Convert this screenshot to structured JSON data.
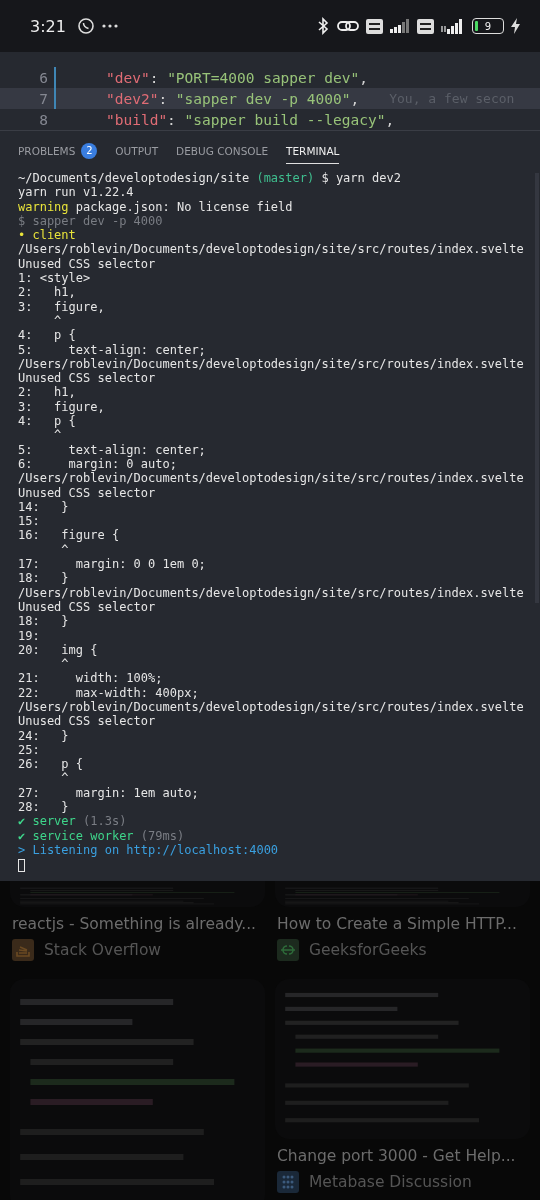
{
  "status_bar": {
    "time": "3:21",
    "battery": "9"
  },
  "editor": {
    "lines": [
      {
        "number": "6",
        "modified": true,
        "highlighted": false,
        "parts": [
          {
            "text": "\"dev\"",
            "kind": "key"
          },
          {
            "text": ": ",
            "kind": "plain"
          },
          {
            "text": "\"PORT=4000 sapper dev\"",
            "kind": "string"
          },
          {
            "text": ",",
            "kind": "plain"
          }
        ]
      },
      {
        "number": "7",
        "modified": true,
        "highlighted": true,
        "blame": "You, a few secon",
        "parts": [
          {
            "text": "\"dev2\"",
            "kind": "key"
          },
          {
            "text": ": ",
            "kind": "plain"
          },
          {
            "text": "\"sapper dev -p 4000\"",
            "kind": "string"
          },
          {
            "text": ",",
            "kind": "plain"
          }
        ]
      },
      {
        "number": "8",
        "modified": false,
        "highlighted": false,
        "parts": [
          {
            "text": "\"build\"",
            "kind": "key"
          },
          {
            "text": ": ",
            "kind": "plain"
          },
          {
            "text": "\"sapper build --legacy\"",
            "kind": "string"
          },
          {
            "text": ",",
            "kind": "plain"
          }
        ]
      }
    ]
  },
  "panel": {
    "tabs": [
      {
        "label": "PROBLEMS",
        "badge": "2",
        "selected": false
      },
      {
        "label": "OUTPUT",
        "selected": false
      },
      {
        "label": "DEBUG CONSOLE",
        "selected": false
      },
      {
        "label": "TERMINAL",
        "selected": true
      }
    ]
  },
  "terminal": {
    "cursor": true,
    "lines": [
      {
        "parts": [
          {
            "text": "~/Documents/developtodesign/site ",
            "kind": "plain"
          },
          {
            "text": "(master)",
            "kind": "branch"
          },
          {
            "text": " $ yarn dev2",
            "kind": "plain"
          }
        ]
      },
      {
        "parts": [
          {
            "text": "yarn run v1.22.4",
            "kind": "plain"
          }
        ]
      },
      {
        "parts": [
          {
            "text": "warning",
            "kind": "warning"
          },
          {
            "text": " package.json: No license field",
            "kind": "plain"
          }
        ]
      },
      {
        "parts": [
          {
            "text": "$ sapper dev -p 4000",
            "kind": "dim"
          }
        ]
      },
      {
        "parts": [
          {
            "text": "• client",
            "kind": "warning"
          }
        ]
      },
      {
        "parts": [
          {
            "text": "/Users/roblevin/Documents/developtodesign/site/src/routes/index.svelte",
            "kind": "plain"
          }
        ]
      },
      {
        "parts": [
          {
            "text": "Unused CSS selector",
            "kind": "plain"
          }
        ]
      },
      {
        "parts": [
          {
            "text": "1: <style>",
            "kind": "plain"
          }
        ]
      },
      {
        "parts": [
          {
            "text": "2:   h1,",
            "kind": "plain"
          }
        ]
      },
      {
        "parts": [
          {
            "text": "3:   figure,",
            "kind": "plain"
          }
        ]
      },
      {
        "parts": [
          {
            "text": "     ^",
            "kind": "plain"
          }
        ]
      },
      {
        "parts": [
          {
            "text": "4:   p {",
            "kind": "plain"
          }
        ]
      },
      {
        "parts": [
          {
            "text": "5:     text-align: center;",
            "kind": "plain"
          }
        ]
      },
      {
        "parts": [
          {
            "text": "/Users/roblevin/Documents/developtodesign/site/src/routes/index.svelte",
            "kind": "plain"
          }
        ]
      },
      {
        "parts": [
          {
            "text": "Unused CSS selector",
            "kind": "plain"
          }
        ]
      },
      {
        "parts": [
          {
            "text": "2:   h1,",
            "kind": "plain"
          }
        ]
      },
      {
        "parts": [
          {
            "text": "3:   figure,",
            "kind": "plain"
          }
        ]
      },
      {
        "parts": [
          {
            "text": "4:   p {",
            "kind": "plain"
          }
        ]
      },
      {
        "parts": [
          {
            "text": "     ^",
            "kind": "plain"
          }
        ]
      },
      {
        "parts": [
          {
            "text": "5:     text-align: center;",
            "kind": "plain"
          }
        ]
      },
      {
        "parts": [
          {
            "text": "6:     margin: 0 auto;",
            "kind": "plain"
          }
        ]
      },
      {
        "parts": [
          {
            "text": "/Users/roblevin/Documents/developtodesign/site/src/routes/index.svelte",
            "kind": "plain"
          }
        ]
      },
      {
        "parts": [
          {
            "text": "Unused CSS selector",
            "kind": "plain"
          }
        ]
      },
      {
        "parts": [
          {
            "text": "14:   }",
            "kind": "plain"
          }
        ]
      },
      {
        "parts": [
          {
            "text": "15:",
            "kind": "plain"
          }
        ]
      },
      {
        "parts": [
          {
            "text": "16:   figure {",
            "kind": "plain"
          }
        ]
      },
      {
        "parts": [
          {
            "text": "      ^",
            "kind": "plain"
          }
        ]
      },
      {
        "parts": [
          {
            "text": "17:     margin: 0 0 1em 0;",
            "kind": "plain"
          }
        ]
      },
      {
        "parts": [
          {
            "text": "18:   }",
            "kind": "plain"
          }
        ]
      },
      {
        "parts": [
          {
            "text": "/Users/roblevin/Documents/developtodesign/site/src/routes/index.svelte",
            "kind": "plain"
          }
        ]
      },
      {
        "parts": [
          {
            "text": "Unused CSS selector",
            "kind": "plain"
          }
        ]
      },
      {
        "parts": [
          {
            "text": "18:   }",
            "kind": "plain"
          }
        ]
      },
      {
        "parts": [
          {
            "text": "19:",
            "kind": "plain"
          }
        ]
      },
      {
        "parts": [
          {
            "text": "20:   img {",
            "kind": "plain"
          }
        ]
      },
      {
        "parts": [
          {
            "text": "      ^",
            "kind": "plain"
          }
        ]
      },
      {
        "parts": [
          {
            "text": "21:     width: 100%;",
            "kind": "plain"
          }
        ]
      },
      {
        "parts": [
          {
            "text": "22:     max-width: 400px;",
            "kind": "plain"
          }
        ]
      },
      {
        "parts": [
          {
            "text": "/Users/roblevin/Documents/developtodesign/site/src/routes/index.svelte",
            "kind": "plain"
          }
        ]
      },
      {
        "parts": [
          {
            "text": "Unused CSS selector",
            "kind": "plain"
          }
        ]
      },
      {
        "parts": [
          {
            "text": "24:   }",
            "kind": "plain"
          }
        ]
      },
      {
        "parts": [
          {
            "text": "25:",
            "kind": "plain"
          }
        ]
      },
      {
        "parts": [
          {
            "text": "26:   p {",
            "kind": "plain"
          }
        ]
      },
      {
        "parts": [
          {
            "text": "      ^",
            "kind": "plain"
          }
        ]
      },
      {
        "parts": [
          {
            "text": "27:     margin: 1em auto;",
            "kind": "plain"
          }
        ]
      },
      {
        "parts": [
          {
            "text": "28:   }",
            "kind": "plain"
          }
        ]
      },
      {
        "parts": [
          {
            "text": "✔ server",
            "kind": "success"
          },
          {
            "text": " (1.3s)",
            "kind": "dim"
          }
        ]
      },
      {
        "parts": [
          {
            "text": "✔ service worker",
            "kind": "success"
          },
          {
            "text": " (79ms)",
            "kind": "dim"
          }
        ]
      },
      {
        "parts": [
          {
            "text": "> Listening on http://localhost:4000",
            "kind": "info"
          }
        ]
      }
    ]
  },
  "results": {
    "columns": [
      [
        {
          "kind": "picture"
        },
        {
          "kind": "result",
          "title": "reactjs - Something is already...",
          "source": "Stack Overflow"
        },
        {
          "kind": "picture"
        }
      ],
      [
        {
          "kind": "picture"
        },
        {
          "kind": "result",
          "title": "How to Create a Simple HTTP...",
          "source": "GeeksforGeeks"
        },
        {
          "kind": "picture"
        },
        {
          "kind": "result",
          "title": "Change port 3000 - Get Help...",
          "source": "Metabase Discussion"
        }
      ]
    ]
  }
}
